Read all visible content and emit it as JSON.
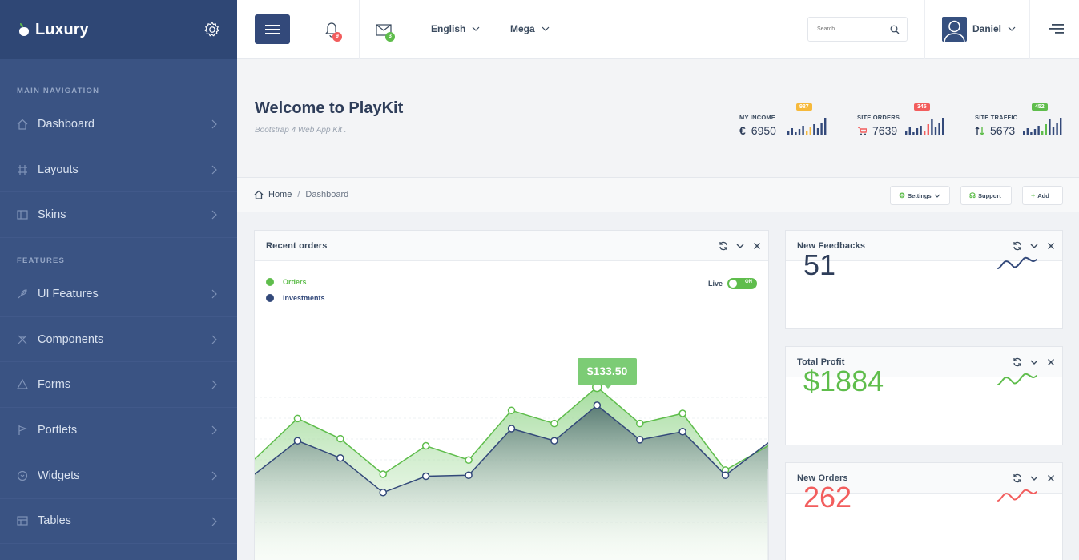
{
  "brand": {
    "name": "Luxury"
  },
  "sidebar": {
    "sections": [
      "MAIN NAVIGATION",
      "FEATURES"
    ],
    "main_items": [
      {
        "label": "Dashboard",
        "icon": "home-icon"
      },
      {
        "label": "Layouts",
        "icon": "layout-icon"
      },
      {
        "label": "Skins",
        "icon": "skins-icon"
      }
    ],
    "feature_items": [
      {
        "label": "UI Features",
        "icon": "feather-icon"
      },
      {
        "label": "Components",
        "icon": "components-icon"
      },
      {
        "label": "Forms",
        "icon": "forms-icon"
      },
      {
        "label": "Portlets",
        "icon": "flag-icon"
      },
      {
        "label": "Widgets",
        "icon": "widgets-icon"
      },
      {
        "label": "Tables",
        "icon": "table-icon"
      }
    ]
  },
  "topbar": {
    "notifications_count": "9",
    "messages_count": "3",
    "language": "English",
    "mega": "Mega",
    "search_placeholder": "Search ...",
    "user": "Daniel"
  },
  "header": {
    "title": "Welcome to PlayKit",
    "subtitle": "Bootstrap 4 Web App Kit .",
    "stats": [
      {
        "label": "MY INCOME",
        "symbol": "€",
        "value": "6950",
        "badge": "987",
        "badge_color": "#f6b93b",
        "bars": [
          6,
          9,
          4,
          8,
          12,
          5,
          10,
          14,
          9,
          16,
          22
        ],
        "highlight": [
          5,
          6
        ],
        "highlight_color": "#f6b93b"
      },
      {
        "label": "SITE ORDERS",
        "symbol": "cart",
        "value": "7639",
        "badge": "345",
        "badge_color": "#f25d5d",
        "bars": [
          6,
          10,
          4,
          9,
          12,
          6,
          14,
          20,
          10,
          15,
          22
        ],
        "highlight": [
          5,
          6
        ],
        "highlight_color": "#f25d5d"
      },
      {
        "label": "SITE TRAFFIC",
        "symbol": "updown",
        "value": "5673",
        "badge": "452",
        "badge_color": "#5fbd4c",
        "bars": [
          6,
          9,
          4,
          8,
          12,
          6,
          14,
          20,
          10,
          15,
          22
        ],
        "highlight": [
          5,
          6
        ],
        "highlight_color": "#5fbd4c"
      }
    ]
  },
  "breadcrumb": {
    "home": "Home",
    "current": "Dashboard",
    "buttons": [
      "Settings",
      "Support",
      "Add"
    ]
  },
  "recent_orders": {
    "title": "Recent orders",
    "legend": [
      {
        "name": "Orders",
        "color": "#5fbd4c"
      },
      {
        "name": "Investments",
        "color": "#33497a"
      }
    ],
    "live_label": "Live",
    "toggle_label": "ON",
    "tooltip": "$133.50"
  },
  "chart_data": {
    "type": "area",
    "series": [
      {
        "name": "Orders",
        "color": "#5fbd4c",
        "values": [
          105,
          145,
          125,
          90,
          118,
          104,
          153,
          140,
          176,
          140,
          150,
          94,
          118
        ]
      },
      {
        "name": "Investments",
        "color": "#33497a",
        "values": [
          90,
          123,
          106,
          72,
          88,
          89,
          135,
          123,
          158,
          124,
          132,
          89,
          121
        ]
      }
    ],
    "highlight_value": "$133.50"
  },
  "kpis": [
    {
      "title": "New Feedbacks",
      "value": "51",
      "color": "#2e3d59",
      "spark_color": "#33497a"
    },
    {
      "title": "Total Profit",
      "value": "$1884",
      "color": "#5fbd4c",
      "spark_color": "#5fbd4c"
    },
    {
      "title": "New Orders",
      "value": "262",
      "color": "#f25d5d",
      "spark_color": "#f25d5d"
    }
  ]
}
